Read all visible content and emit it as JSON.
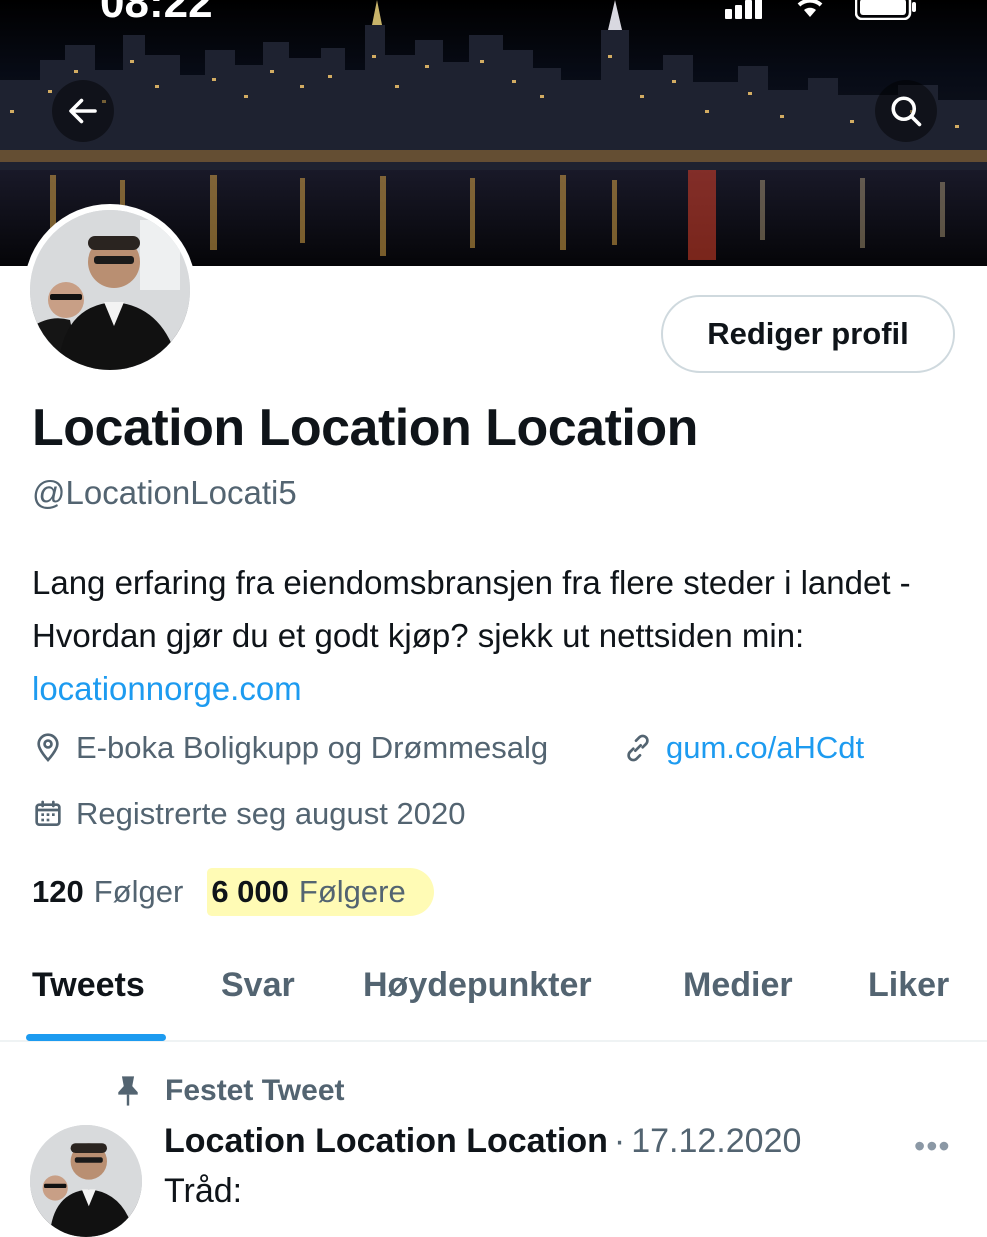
{
  "status_bar": {
    "time": "08:22"
  },
  "banner": {
    "back_icon": "arrow-left-icon",
    "search_icon": "search-icon"
  },
  "profile": {
    "edit_button": "Rediger profil",
    "display_name": "Location Location Location",
    "handle": "@LocationLocati5",
    "bio_text": "Lang erfaring fra eiendomsbransjen fra flere steder i landet - Hvordan gjør du et godt kjøp? sjekk ut nettsiden min: ",
    "bio_link": "locationnorge.com",
    "location": "E-boka Boligkupp og Drømmesalg",
    "website": "gum.co/aHCdt",
    "joined": "Registrerte seg august 2020",
    "following_count": "120",
    "following_label": "Følger",
    "followers_count": "6 000",
    "followers_label": "Følgere",
    "highlight_color": "#fff878"
  },
  "tabs": [
    {
      "label": "Tweets"
    },
    {
      "label": "Svar"
    },
    {
      "label": "Høydepunkter"
    },
    {
      "label": "Medier"
    },
    {
      "label": "Liker"
    }
  ],
  "pinned_tweet": {
    "pinned_label": "Festet Tweet",
    "author": "Location Location Location",
    "separator": "·",
    "date": "17.12.2020",
    "more": "•••",
    "text": "Tråd:"
  },
  "colors": {
    "accent": "#1d9bf0",
    "secondary_text": "#536471",
    "primary_text": "#0f1419"
  }
}
